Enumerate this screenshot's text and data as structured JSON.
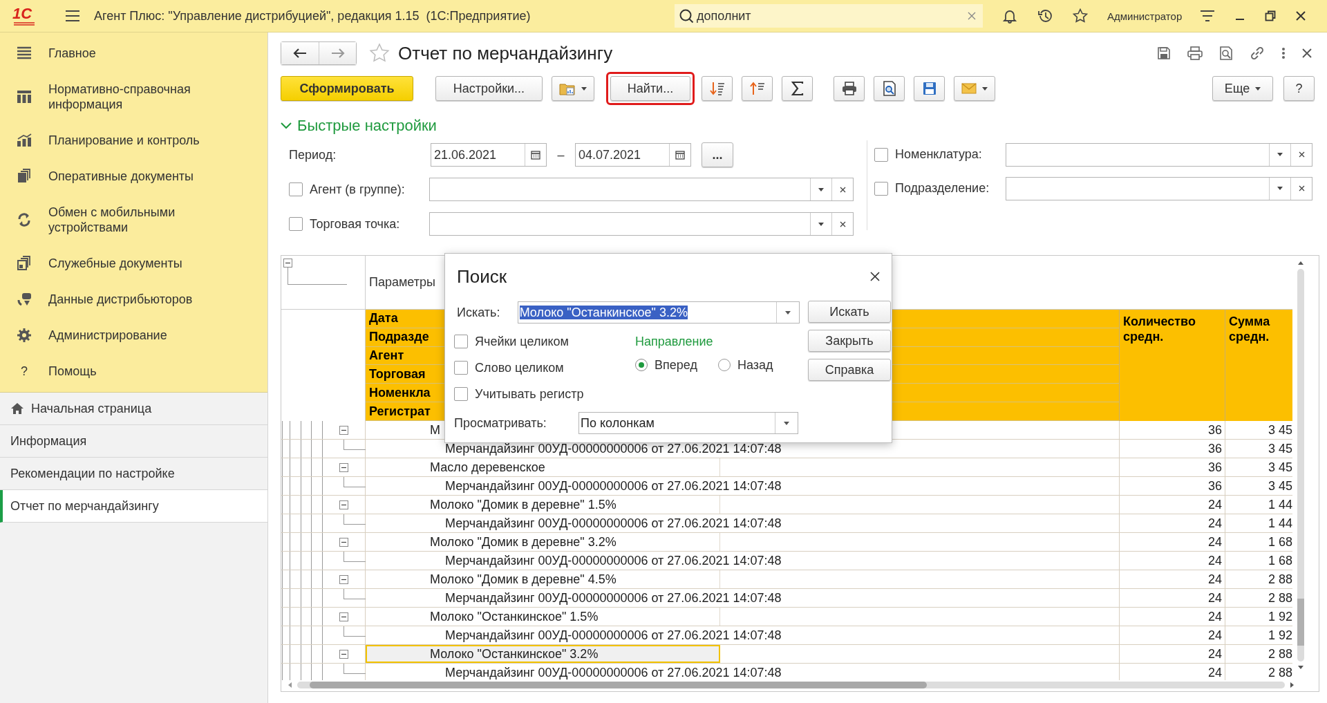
{
  "app_bar": {
    "logo": "1С",
    "title": "Агент Плюс: \"Управление дистрибуцией\", редакция 1.15  (1С:Предприятие)",
    "search": {
      "value": "дополнит"
    },
    "user": "Администратор"
  },
  "sidebar": {
    "sections": [
      {
        "label": "Главное"
      },
      {
        "label": "Нормативно-справочная информация"
      },
      {
        "label": "Планирование и контроль"
      },
      {
        "label": "Оперативные документы"
      },
      {
        "label": "Обмен с мобильными устройствами"
      },
      {
        "label": "Служебные документы"
      },
      {
        "label": "Данные дистрибьюторов"
      },
      {
        "label": "Администрирование"
      },
      {
        "label": "Помощь",
        "glyph": "?"
      }
    ],
    "open_pages": [
      {
        "label": "Начальная страница",
        "selected": false
      },
      {
        "label": "Информация",
        "selected": false
      },
      {
        "label": "Рекомендации по настройке",
        "selected": false
      },
      {
        "label": "Отчет по мерчандайзингу",
        "selected": true
      }
    ]
  },
  "form": {
    "title": "Отчет по мерчандайзингу",
    "toolbar": {
      "generate": "Сформировать",
      "settings": "Настройки...",
      "find": {
        "label": "Найти...",
        "highlighted": true
      },
      "more": "Еще",
      "help": "?"
    },
    "quick_settings": {
      "title": "Быстрые настройки",
      "expanded": true,
      "period": {
        "label": "Период:",
        "from": "21.06.2021",
        "dash": "–",
        "to": "04.07.2021",
        "more": "..."
      },
      "left_filters": [
        {
          "label": "Агент (в группе):",
          "checked": false
        },
        {
          "label": "Торговая точка:",
          "checked": false
        }
      ],
      "right_filters": [
        {
          "label": "Номенклатура:",
          "checked": false
        },
        {
          "label": "Подразделение:",
          "checked": false
        }
      ]
    },
    "report": {
      "parameters_label": "Параметры",
      "header_rows": [
        "Дата",
        "Подразде",
        "Агент",
        "Торговая",
        "Номенкла",
        "Регистрат"
      ],
      "columns": [
        "Количество средн.",
        "Сумма средн."
      ],
      "rows": [
        {
          "kind": "group",
          "text": "М",
          "qty": "36",
          "sum": "3 45",
          "selected": false
        },
        {
          "kind": "detail",
          "text": "Мерчандайзинг 00УД-00000000006 от 27.06.2021 14:07:48",
          "qty": "36",
          "sum": "3 45",
          "selected": false
        },
        {
          "kind": "group",
          "text": "Масло деревенское",
          "qty": "36",
          "sum": "3 45",
          "selected": false
        },
        {
          "kind": "detail",
          "text": "Мерчандайзинг 00УД-00000000006 от 27.06.2021 14:07:48",
          "qty": "36",
          "sum": "3 45",
          "selected": false
        },
        {
          "kind": "group",
          "text": "Молоко \"Домик в деревне\" 1.5%",
          "qty": "24",
          "sum": "1 44",
          "selected": false
        },
        {
          "kind": "detail",
          "text": "Мерчандайзинг 00УД-00000000006 от 27.06.2021 14:07:48",
          "qty": "24",
          "sum": "1 44",
          "selected": false
        },
        {
          "kind": "group",
          "text": "Молоко \"Домик в деревне\" 3.2%",
          "qty": "24",
          "sum": "1 68",
          "selected": false
        },
        {
          "kind": "detail",
          "text": "Мерчандайзинг 00УД-00000000006 от 27.06.2021 14:07:48",
          "qty": "24",
          "sum": "1 68",
          "selected": false
        },
        {
          "kind": "group",
          "text": "Молоко \"Домик в деревне\" 4.5%",
          "qty": "24",
          "sum": "2 88",
          "selected": false
        },
        {
          "kind": "detail",
          "text": "Мерчандайзинг 00УД-00000000006 от 27.06.2021 14:07:48",
          "qty": "24",
          "sum": "2 88",
          "selected": false
        },
        {
          "kind": "group",
          "text": "Молоко \"Останкинское\" 1.5%",
          "qty": "24",
          "sum": "1 92",
          "selected": false
        },
        {
          "kind": "detail",
          "text": "Мерчандайзинг 00УД-00000000006 от 27.06.2021 14:07:48",
          "qty": "24",
          "sum": "1 92",
          "selected": false
        },
        {
          "kind": "group",
          "text": "Молоко \"Останкинское\" 3.2%",
          "qty": "24",
          "sum": "2 88",
          "selected": true
        },
        {
          "kind": "detail",
          "text": "Мерчандайзинг 00УД-00000000006 от 27.06.2021 14:07:48",
          "qty": "24",
          "sum": "2 88",
          "selected": false
        }
      ]
    }
  },
  "find_dialog": {
    "title": "Поиск",
    "search_label": "Искать:",
    "search_value": "Молоко \"Останкинское\" 3.2%",
    "buttons": [
      "Искать",
      "Закрыть",
      "Справка"
    ],
    "options": [
      {
        "label": "Ячейки целиком",
        "checked": false
      },
      {
        "label": "Слово целиком",
        "checked": false
      },
      {
        "label": "Учитывать регистр",
        "checked": false
      }
    ],
    "direction": {
      "label": "Направление",
      "options": [
        {
          "label": "Вперед",
          "selected": true
        },
        {
          "label": "Назад",
          "selected": false
        }
      ]
    },
    "view": {
      "label": "Просматривать:",
      "value": "По колонкам"
    }
  }
}
